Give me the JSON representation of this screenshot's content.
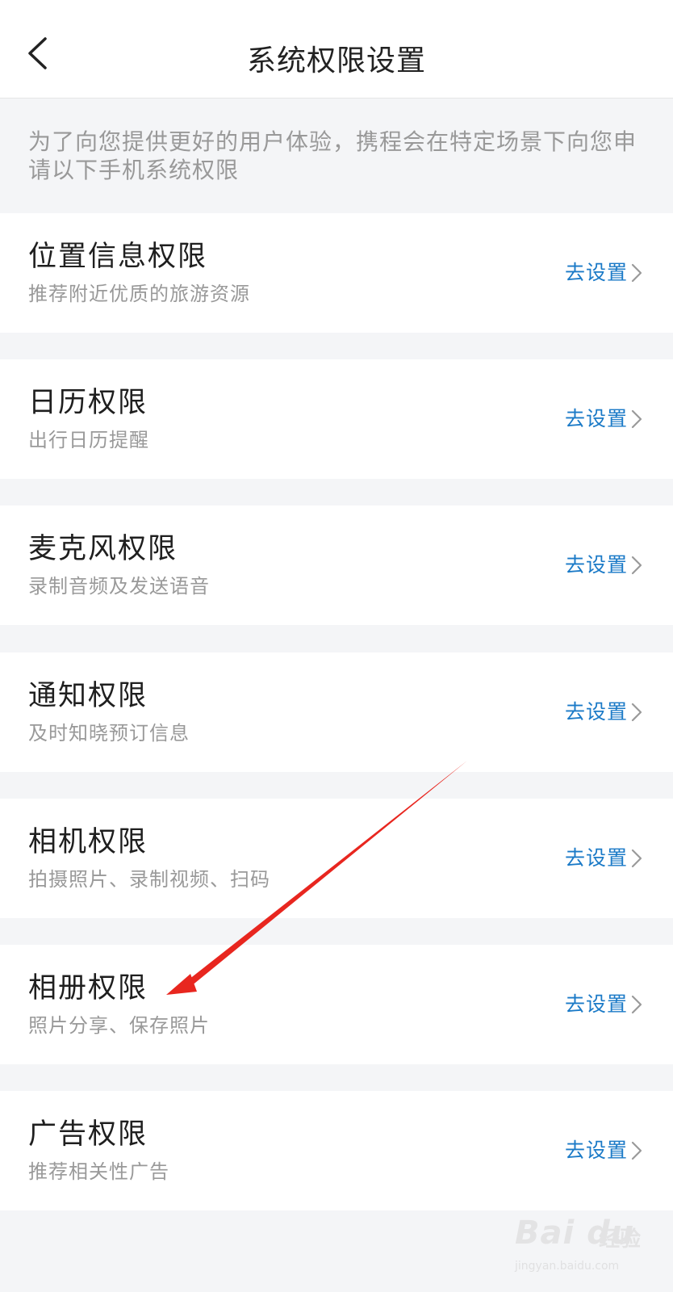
{
  "header": {
    "title": "系统权限设置"
  },
  "intro": "为了向您提供更好的用户体验，携程会在特定场景下向您申请以下手机系统权限",
  "permissions": [
    {
      "title": "位置信息权限",
      "subtitle": "推荐附近优质的旅游资源",
      "action": "去设置"
    },
    {
      "title": "日历权限",
      "subtitle": "出行日历提醒",
      "action": "去设置"
    },
    {
      "title": "麦克风权限",
      "subtitle": "录制音频及发送语音",
      "action": "去设置"
    },
    {
      "title": "通知权限",
      "subtitle": "及时知晓预订信息",
      "action": "去设置"
    },
    {
      "title": "相机权限",
      "subtitle": "拍摄照片、录制视频、扫码",
      "action": "去设置"
    },
    {
      "title": "相册权限",
      "subtitle": "照片分享、保存照片",
      "action": "去设置"
    },
    {
      "title": "广告权限",
      "subtitle": "推荐相关性广告",
      "action": "去设置"
    }
  ],
  "watermark": {
    "logo": "Bai du",
    "experience": "经验",
    "url": "jingyan.baidu.com"
  },
  "colors": {
    "accent": "#1b7ac7",
    "annotation_arrow": "#e8261f",
    "background": "#f4f5f7"
  },
  "icons": {
    "back": "back-arrow-icon",
    "row_chevron": "chevron-right-icon",
    "annotation": "red-arrow-annotation"
  }
}
